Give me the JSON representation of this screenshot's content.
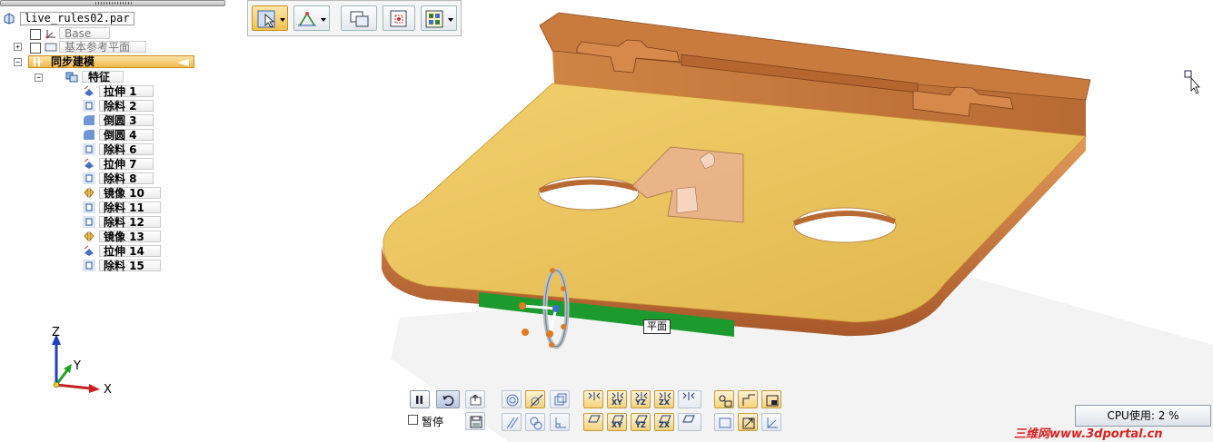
{
  "pathfinder": {
    "file_name": "live_rules02.par",
    "base_label": "Base",
    "refplanes_label": "基本参考平面",
    "sync_label": "同步建模",
    "features_label": "特征",
    "features": [
      {
        "label": "拉伸 1",
        "icon": "extrude-icon"
      },
      {
        "label": "除料 2",
        "icon": "cutout-icon"
      },
      {
        "label": "倒圆 3",
        "icon": "round-icon"
      },
      {
        "label": "倒圆 4",
        "icon": "round-icon"
      },
      {
        "label": "除料 6",
        "icon": "cutout-icon"
      },
      {
        "label": "拉伸 7",
        "icon": "extrude-icon"
      },
      {
        "label": "除料 8",
        "icon": "cutout-icon"
      },
      {
        "label": "镜像 10",
        "icon": "mirror-icon"
      },
      {
        "label": "除料 11",
        "icon": "cutout-icon"
      },
      {
        "label": "除料 12",
        "icon": "cutout-icon"
      },
      {
        "label": "镜像 13",
        "icon": "mirror-icon"
      },
      {
        "label": "拉伸 14",
        "icon": "extrude-icon"
      },
      {
        "label": "除料 15",
        "icon": "cutout-icon"
      }
    ]
  },
  "triad": {
    "z": "Z",
    "y": "Y",
    "x": "X"
  },
  "viewport": {
    "face_tooltip": "平面"
  },
  "live_rules": {
    "pause_label": "暂停",
    "row1_labels": [
      "",
      "XY",
      "YZ",
      "ZX",
      ""
    ],
    "row2_labels": [
      "",
      "XY",
      "YZ",
      "ZX",
      ""
    ]
  },
  "status": {
    "cpu_text": "CPU使用: 2 %"
  },
  "watermark": {
    "text": "三维网www.3dportal.cn"
  },
  "colors": {
    "plate_top": "#e8c257",
    "copper": "#c8743a",
    "selected_edge": "#1c9a2e",
    "ribbon_active": "#f3c14f"
  }
}
